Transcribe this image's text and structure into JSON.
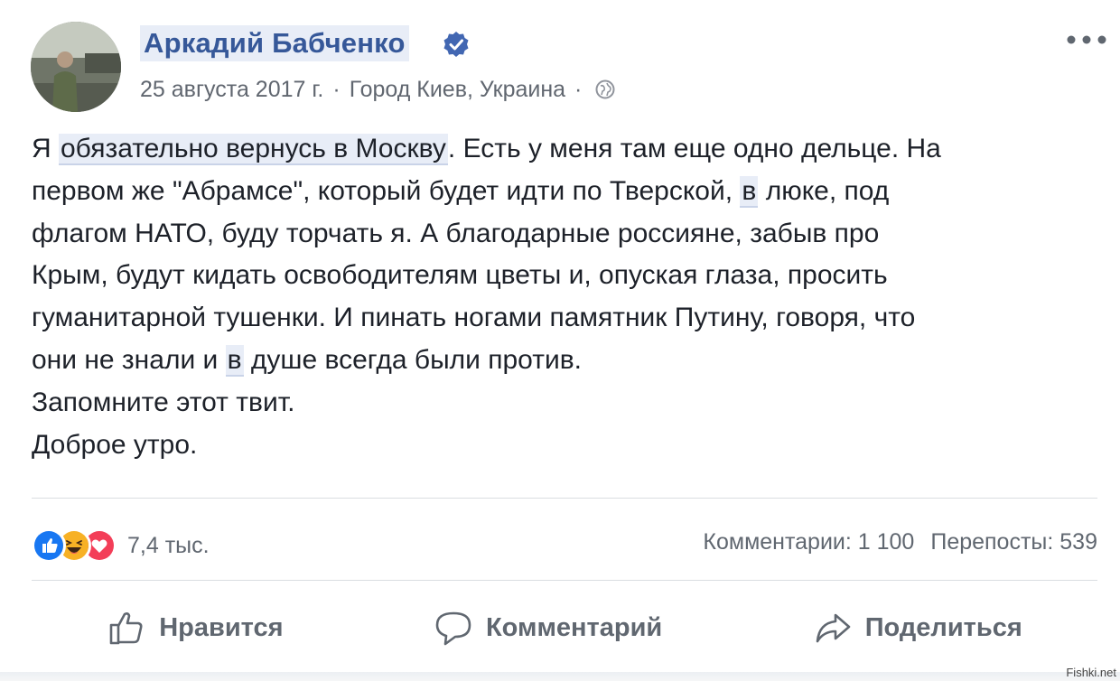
{
  "post": {
    "author": "Аркадий Бабченко",
    "date": "25 августа 2017 г.",
    "separator": "·",
    "location": "Город Киев, Украина",
    "separator2": "·",
    "icons": {
      "verified": "verified-badge-icon",
      "privacy": "globe-icon",
      "more": "more-options-icon"
    },
    "colors": {
      "name": "#365899",
      "verified": "#4267b2",
      "meta": "#616770"
    }
  },
  "body": {
    "line1_a": "Я ",
    "line1_hl": "обязательно вернусь в Москву",
    "line1_b": ". Есть у меня там еще одно дельце. На",
    "line2_a": "первом же \"Абрамсе\", который будет идти по Тверской, ",
    "line2_hl": "в",
    "line2_b": " люке, под",
    "line3": "флагом НАТО, буду торчать я. А благодарные россияне, забыв про",
    "line4": "Крым, будут кидать освободителям цветы и, опуская глаза, просить",
    "line5": "гуманитарной тушенки. И пинать ногами памятник Путину, говоря, что",
    "line6_a": "они не знали и ",
    "line6_hl": "в",
    "line6_b": " душе всегда были против.",
    "line7": "Запомните этот твит.",
    "line8": "Доброе утро."
  },
  "reactions": {
    "items": [
      "like-reaction-icon",
      "haha-reaction-icon",
      "love-reaction-icon"
    ],
    "count": "7,4 тыс.",
    "colors": {
      "like": "#1877f2",
      "haha": "#f7b125",
      "love": "#f33e58"
    }
  },
  "stats": {
    "comments": "Комментарии: 1 100",
    "shares": "Перепосты: 539"
  },
  "actions": {
    "like": "Нравится",
    "comment": "Комментарий",
    "share": "Поделиться"
  },
  "watermark": "Fishki.net"
}
